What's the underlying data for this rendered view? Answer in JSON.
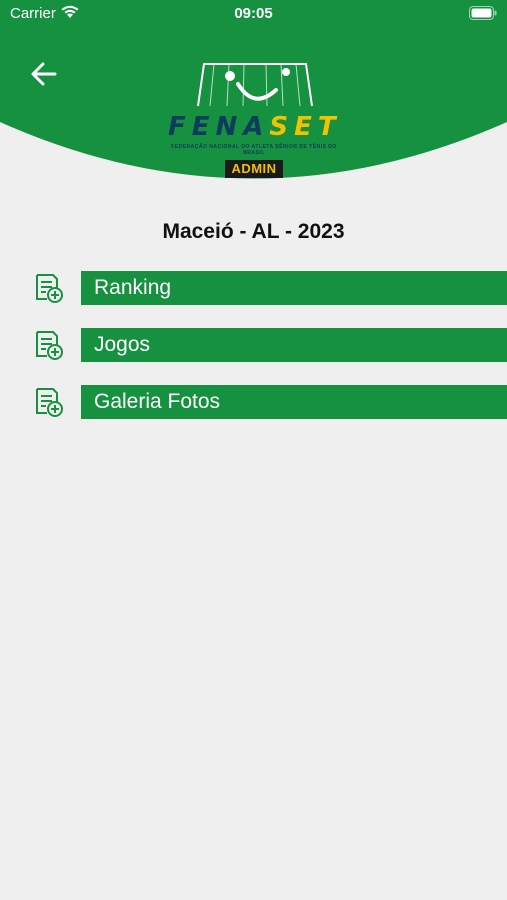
{
  "status_bar": {
    "carrier": "Carrier",
    "time": "09:05"
  },
  "header": {
    "logo_text_main": "FENA",
    "logo_text_accent": "SET",
    "logo_subtitle": "FEDERAÇÃO NACIONAL DO ATLETA SÊNIOR DE TÊNIS DO BRASIL",
    "admin_badge": "ADMIN",
    "brand_green": "#15913f"
  },
  "page": {
    "title": "Maceió - AL - 2023"
  },
  "menu": [
    {
      "label": "Ranking",
      "icon": "document-add-icon"
    },
    {
      "label": "Jogos",
      "icon": "document-add-icon"
    },
    {
      "label": "Galeria Fotos",
      "icon": "document-add-icon"
    }
  ]
}
